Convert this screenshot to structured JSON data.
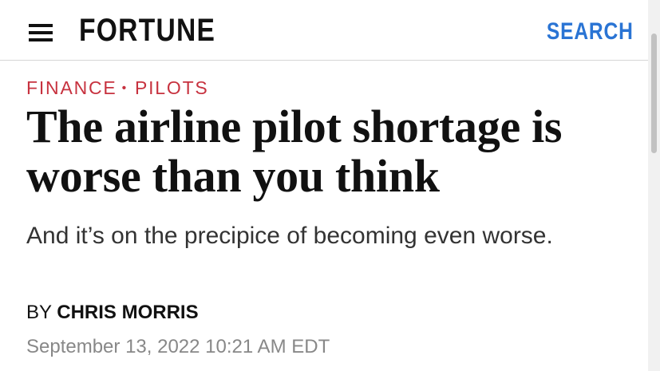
{
  "header": {
    "logo": "FORTUNE",
    "search_label": "SEARCH",
    "menu_icon": "hamburger-menu-icon"
  },
  "article": {
    "tags": [
      "FINANCE",
      "PILOTS"
    ],
    "tag_separator": "•",
    "headline": "The airline pilot shortage is worse than you think",
    "subheadline": "And it’s on the precipice of becoming even worse.",
    "byline_prefix": "BY",
    "author": "CHRIS MORRIS",
    "timestamp": "September 13, 2022 10:21 AM EDT"
  },
  "colors": {
    "tag": "#c7323f",
    "search": "#2a74d4",
    "text": "#111111",
    "muted": "#888888"
  }
}
